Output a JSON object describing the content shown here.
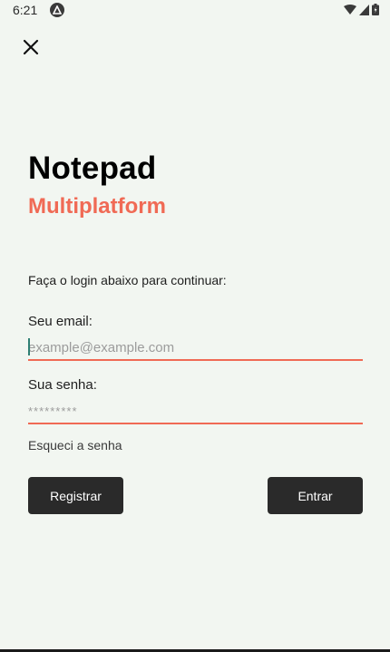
{
  "status_bar": {
    "time": "6:21",
    "app_icon": "android-a-icon",
    "wifi_icon": "wifi-icon",
    "signal_icon": "signal-icon",
    "battery_icon": "battery-icon"
  },
  "toolbar": {
    "close_icon": "close-icon"
  },
  "header": {
    "title": "Notepad",
    "subtitle": "Multiplatform"
  },
  "form": {
    "instruction": "Faça o login abaixo para continuar:",
    "email_label": "Seu email:",
    "email_placeholder": "example@example.com",
    "email_value": "",
    "password_label": "Sua senha:",
    "password_placeholder": "*********",
    "password_value": "",
    "forgot_label": "Esqueci a senha",
    "register_label": "Registrar",
    "login_label": "Entrar"
  },
  "colors": {
    "accent": "#F06A55",
    "button_bg": "#2A2A2A",
    "background": "#F2F6F1"
  }
}
